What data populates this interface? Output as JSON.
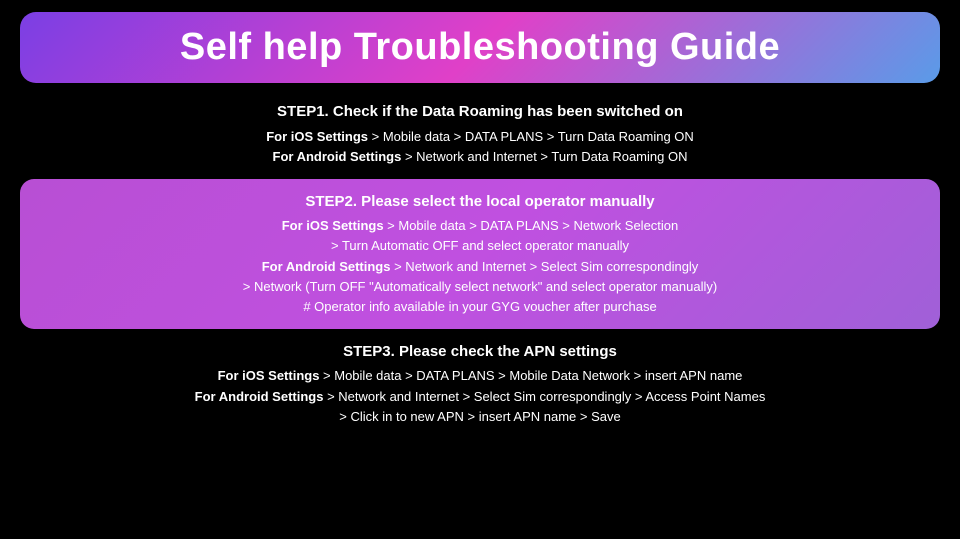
{
  "title": "Self help Troubleshooting Guide",
  "steps": [
    {
      "id": "step1",
      "highlighted": false,
      "title": "STEP1. Check if the Data Roaming has been switched on",
      "lines": [
        "<span class=\"bold\">For iOS Settings</span> > Mobile data > DATA PLANS > Turn Data Roaming ON",
        "<span class=\"bold\">For Android Settings</span> > Network and Internet > Turn Data Roaming ON"
      ]
    },
    {
      "id": "step2",
      "highlighted": true,
      "title": "STEP2. Please select the local operator manually",
      "lines": [
        "<span class=\"bold\">For iOS Settings</span> > Mobile data > DATA PLANS > Network Selection",
        "> Turn Automatic OFF and select operator manually",
        "<span class=\"bold\">For Android Settings</span> > Network and Internet > Select Sim correspondingly",
        "> Network (Turn OFF \"Automatically select network\" and select operator manually)",
        "# Operator info available in your GYG voucher after purchase"
      ]
    },
    {
      "id": "step3",
      "highlighted": false,
      "title": "STEP3. Please check the APN settings",
      "lines": [
        "<span class=\"bold\">For iOS Settings</span> > Mobile data > DATA PLANS > Mobile Data Network > insert APN name",
        "<span class=\"bold\">For Android Settings</span> > Network and Internet > Select Sim correspondingly > Access Point Names",
        "> Click in to new APN > insert APN name > Save"
      ]
    }
  ]
}
